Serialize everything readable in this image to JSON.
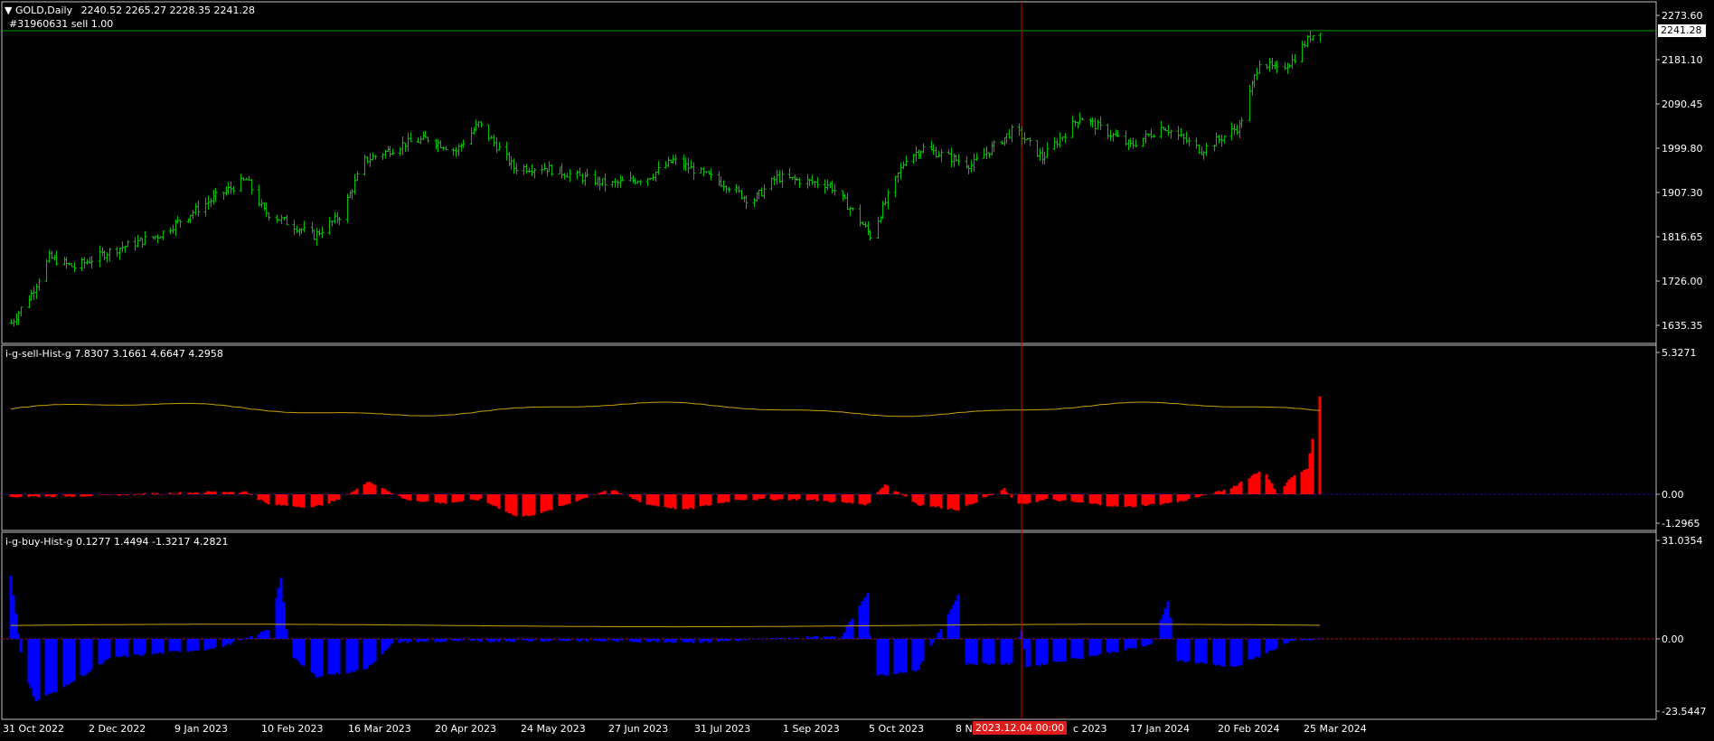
{
  "symbol": {
    "title": "GOLD,Daily",
    "ohlc": "2240.52 2265.27 2228.35 2241.28",
    "order": "#31960631 sell 1.00",
    "current_price": "2241.28"
  },
  "price_axis": [
    "2273.60",
    "2181.10",
    "2090.45",
    "1999.80",
    "1907.30",
    "1816.65",
    "1726.00",
    "1635.35"
  ],
  "sell_indicator": {
    "title": "i-g-sell-Hist-g 7.8307 3.1661 4.6647 4.2958",
    "axis": [
      "5.3271",
      "0.00",
      "-1.2965"
    ]
  },
  "buy_indicator": {
    "title": "i-g-buy-Hist-g 0.1277 1.4494 -1.3217 4.2821",
    "axis": [
      "31.0354",
      "0.00",
      "-23.5447"
    ]
  },
  "time_axis": [
    "31 Oct 2022",
    "2 Dec 2022",
    "9 Jan 2023",
    "10 Feb 2023",
    "16 Mar 2023",
    "20 Apr 2023",
    "24 May 2023",
    "27 Jun 2023",
    "31 Jul 2023",
    "1 Sep 2023",
    "5 Oct 2023",
    "8 N",
    "c 2023",
    "17 Jan 2024",
    "20 Feb 2024",
    "25 Mar 2024"
  ],
  "cursor_date": "2023.12.04 00:00",
  "colors": {
    "bars": "#00c000",
    "sell_hist": "#ff0000",
    "buy_hist": "#0000ff",
    "signal_line": "#c8a000",
    "cursor": "#c80000",
    "frame": "#c0c0c0"
  },
  "chart_data": {
    "type": "ohlc",
    "price_keypoints": [
      [
        "2022-10-31",
        1640
      ],
      [
        "2022-11-08",
        1700
      ],
      [
        "2022-11-15",
        1775
      ],
      [
        "2022-11-25",
        1755
      ],
      [
        "2022-12-10",
        1790
      ],
      [
        "2022-12-28",
        1820
      ],
      [
        "2023-01-20",
        1900
      ],
      [
        "2023-02-01",
        1935
      ],
      [
        "2023-02-08",
        1870
      ],
      [
        "2023-02-28",
        1820
      ],
      [
        "2023-03-10",
        1860
      ],
      [
        "2023-03-20",
        1975
      ],
      [
        "2023-04-05",
        2010
      ],
      [
        "2023-04-14",
        2020
      ],
      [
        "2023-04-25",
        1995
      ],
      [
        "2023-05-04",
        2050
      ],
      [
        "2023-05-18",
        1960
      ],
      [
        "2023-05-30",
        1960
      ],
      [
        "2023-06-25",
        1925
      ],
      [
        "2023-07-10",
        1940
      ],
      [
        "2023-07-20",
        1975
      ],
      [
        "2023-08-10",
        1925
      ],
      [
        "2023-08-20",
        1890
      ],
      [
        "2023-08-30",
        1940
      ],
      [
        "2023-09-20",
        1925
      ],
      [
        "2023-09-30",
        1865
      ],
      [
        "2023-10-06",
        1820
      ],
      [
        "2023-10-20",
        1980
      ],
      [
        "2023-10-27",
        2000
      ],
      [
        "2023-11-15",
        1965
      ],
      [
        "2023-12-01",
        2035
      ],
      [
        "2023-12-04",
        2030
      ],
      [
        "2023-12-13",
        1980
      ],
      [
        "2023-12-28",
        2065
      ],
      [
        "2024-01-17",
        2005
      ],
      [
        "2024-01-30",
        2045
      ],
      [
        "2024-02-14",
        1995
      ],
      [
        "2024-02-29",
        2045
      ],
      [
        "2024-03-08",
        2180
      ],
      [
        "2024-03-15",
        2160
      ],
      [
        "2024-03-21",
        2180
      ],
      [
        "2024-03-28",
        2230
      ],
      [
        "2024-04-01",
        2245
      ]
    ],
    "sell_hist_keypoints": [
      [
        "2022-10-31",
        -0.1
      ],
      [
        "2022-12-05",
        -0.05
      ],
      [
        "2023-01-20",
        0.1
      ],
      [
        "2023-02-01",
        0.1
      ],
      [
        "2023-02-10",
        -0.4
      ],
      [
        "2023-02-28",
        -0.5
      ],
      [
        "2023-03-10",
        -0.2
      ],
      [
        "2023-03-22",
        0.5
      ],
      [
        "2023-04-05",
        -0.2
      ],
      [
        "2023-04-20",
        -0.35
      ],
      [
        "2023-05-05",
        -0.2
      ],
      [
        "2023-05-20",
        -0.9
      ],
      [
        "2023-05-30",
        -0.7
      ],
      [
        "2023-06-25",
        0.2
      ],
      [
        "2023-07-10",
        -0.4
      ],
      [
        "2023-07-25",
        -0.6
      ],
      [
        "2023-08-15",
        -0.2
      ],
      [
        "2023-09-10",
        -0.2
      ],
      [
        "2023-10-05",
        -0.4
      ],
      [
        "2023-10-12",
        0.4
      ],
      [
        "2023-10-25",
        -0.4
      ],
      [
        "2023-11-10",
        -0.6
      ],
      [
        "2023-11-28",
        0.2
      ],
      [
        "2023-12-04",
        -0.4
      ],
      [
        "2023-12-15",
        -0.2
      ],
      [
        "2024-01-15",
        -0.5
      ],
      [
        "2024-02-05",
        -0.3
      ],
      [
        "2024-02-25",
        0.2
      ],
      [
        "2024-03-10",
        1.0
      ],
      [
        "2024-03-15",
        0.0
      ],
      [
        "2024-03-20",
        0.6
      ],
      [
        "2024-03-27",
        1.0
      ],
      [
        "2024-04-01",
        3.8
      ]
    ],
    "buy_hist_keypoints": [
      [
        "2022-10-31",
        20
      ],
      [
        "2022-11-05",
        -10
      ],
      [
        "2022-11-10",
        -20
      ],
      [
        "2022-11-22",
        -15
      ],
      [
        "2022-12-10",
        -6
      ],
      [
        "2023-01-20",
        -3
      ],
      [
        "2023-02-01",
        0
      ],
      [
        "2023-02-10",
        3
      ],
      [
        "2023-02-15",
        20
      ],
      [
        "2023-02-18",
        -5
      ],
      [
        "2023-03-01",
        -12
      ],
      [
        "2023-03-20",
        -10
      ],
      [
        "2023-04-01",
        -1
      ],
      [
        "2023-06-01",
        -0.5
      ],
      [
        "2023-08-01",
        -1
      ],
      [
        "2023-09-25",
        1
      ],
      [
        "2023-10-05",
        15
      ],
      [
        "2023-10-07",
        -12
      ],
      [
        "2023-10-25",
        -10
      ],
      [
        "2023-11-10",
        14
      ],
      [
        "2023-11-12",
        -8
      ],
      [
        "2023-12-01",
        -8
      ],
      [
        "2023-12-05",
        3
      ],
      [
        "2023-12-07",
        -9
      ],
      [
        "2024-01-05",
        -5
      ],
      [
        "2024-01-25",
        -2
      ],
      [
        "2024-02-01",
        12
      ],
      [
        "2024-02-05",
        -7
      ],
      [
        "2024-02-28",
        -9
      ],
      [
        "2024-03-20",
        -1
      ],
      [
        "2024-04-01",
        0
      ]
    ],
    "sell_signal_level": 3.3,
    "buy_signal_level": 4.3
  }
}
